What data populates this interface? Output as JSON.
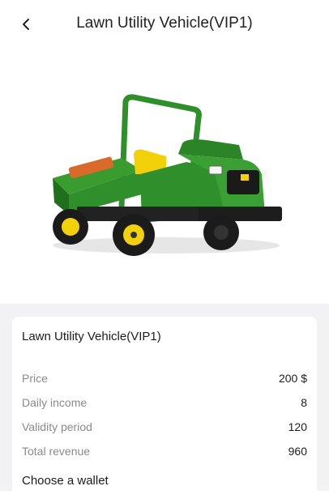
{
  "header": {
    "title": "Lawn Utility Vehicle(VIP1)"
  },
  "product": {
    "image_icon": "utility-vehicle-image",
    "name": "Lawn Utility Vehicle(VIP1)",
    "details": [
      {
        "label": "Price",
        "value": "200 $"
      },
      {
        "label": "Daily income",
        "value": "8"
      },
      {
        "label": "Validity period",
        "value": "120"
      },
      {
        "label": "Total revenue",
        "value": "960"
      }
    ]
  },
  "wallet": {
    "title": "Choose a wallet"
  },
  "colors": {
    "brand_green": "#2f8f2a",
    "brand_yellow": "#f2d00a"
  }
}
